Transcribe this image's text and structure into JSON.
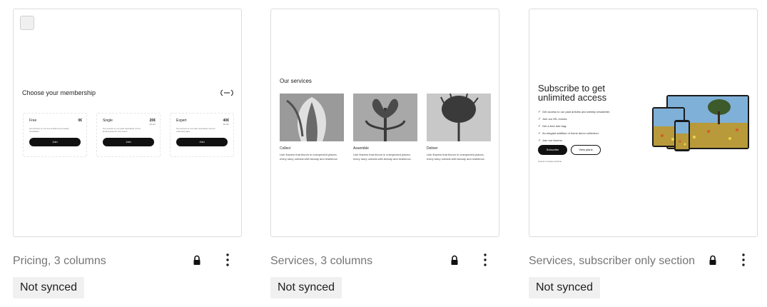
{
  "cards": [
    {
      "title": "Pricing, 3 columns",
      "status": "Not synced",
      "preview": {
        "heading": "Choose your membership",
        "plans": [
          {
            "name": "Free",
            "price": "0€",
            "period": "",
            "desc": "Get access to our free articles and weekly newsletter.",
            "button": "Join"
          },
          {
            "name": "Single",
            "price": "20€",
            "period": "Month",
            "desc": "Get access to our paid newsletter and a limited pass for one event.",
            "button": "Join"
          },
          {
            "name": "Expert",
            "price": "40€",
            "period": "Month",
            "desc": "Get access to our paid newsletter and an unlimited pass.",
            "button": "Join"
          }
        ]
      }
    },
    {
      "title": "Services, 3 columns",
      "status": "Not synced",
      "preview": {
        "heading": "Our services",
        "items": [
          {
            "name": "Collect",
            "desc": "Like flowers that bloom in unexpected places, every story unfolds with beauty and resilience."
          },
          {
            "name": "Assemble",
            "desc": "Like flowers that bloom in unexpected places, every story unfolds with beauty and resilience."
          },
          {
            "name": "Deliver",
            "desc": "Like flowers that bloom in unexpected places, every story unfolds with beauty and resilience."
          }
        ]
      }
    },
    {
      "title": "Services, subscriber only section",
      "status": "Not synced",
      "preview": {
        "heading": "Subscribe to get unlimited access",
        "benefits": [
          "Get access to our paid articles and weekly newsletter.",
          "Join our IRL events.",
          "Get a free tote bag.",
          "An elegant addition of home decor collection.",
          "Join our forums."
        ],
        "subscribe_button": "Subscribe",
        "view_plans_button": "View plans",
        "cancel_note": "Cancel or pause anytime."
      }
    }
  ],
  "icons": {
    "lock": "lock-icon",
    "more": "more-vertical-icon"
  },
  "colors": {
    "card_border": "#dcdcde",
    "title_text": "#757575",
    "badge_bg": "#f0f0f0",
    "button_dark": "#111111"
  }
}
